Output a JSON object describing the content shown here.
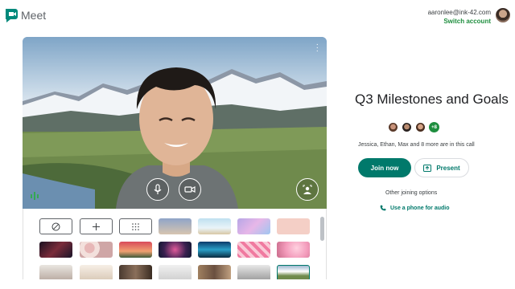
{
  "app": {
    "name": "Meet",
    "logo_icon": "meet-logo-icon"
  },
  "account": {
    "email": "aaronlee@ink-42.com",
    "switch_label": "Switch account"
  },
  "preview": {
    "more_icon": "more-vert-icon",
    "controls": [
      "microphone-icon",
      "camera-icon"
    ],
    "effects_icon": "background-effects-icon",
    "audio_indicator_icon": "audio-level-icon"
  },
  "backgrounds": {
    "options": [
      {
        "name": "no-effect",
        "icon": "slash-circle-icon"
      },
      {
        "name": "upload",
        "icon": "plus-icon"
      },
      {
        "name": "blur",
        "icon": "blur-dots-icon"
      }
    ],
    "colors": {
      "accent": "#00796b",
      "join_button": "#00796b",
      "avatar_more": "#1e8e3e"
    }
  },
  "meeting": {
    "title": "Q3 Milestones and Goals",
    "participants_more": "+8",
    "in_call_text": "Jessica, Ethan, Max and 8 more are in this call",
    "join_label": "Join now",
    "present_label": "Present",
    "other_options_label": "Other joining options",
    "phone_label": "Use a phone for audio"
  }
}
